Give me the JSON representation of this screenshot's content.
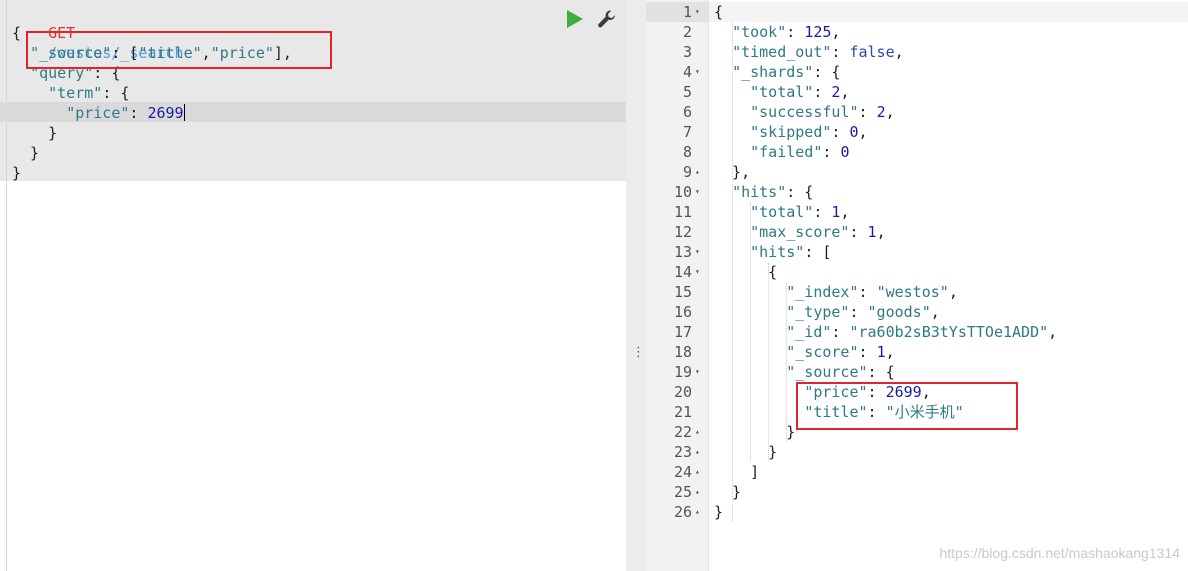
{
  "request": {
    "method": "GET",
    "path": "/westos/_search",
    "lines": [
      [
        [
          "p",
          "{"
        ]
      ],
      [
        [
          "p",
          "  "
        ],
        [
          "k",
          "\"_source\""
        ],
        [
          "p",
          ": ["
        ],
        [
          "s",
          "\"title\""
        ],
        [
          "p",
          ","
        ],
        [
          "s",
          "\"price\""
        ],
        [
          "p",
          "],"
        ]
      ],
      [
        [
          "p",
          "  "
        ],
        [
          "k",
          "\"query\""
        ],
        [
          "p",
          ": {"
        ]
      ],
      [
        [
          "p",
          "    "
        ],
        [
          "k",
          "\"term\""
        ],
        [
          "p",
          ": {"
        ]
      ],
      [
        [
          "p",
          "      "
        ],
        [
          "k",
          "\"price\""
        ],
        [
          "p",
          ": "
        ],
        [
          "n",
          "2699"
        ]
      ],
      [
        [
          "p",
          "    }"
        ]
      ],
      [
        [
          "p",
          "  }"
        ]
      ],
      [
        [
          "p",
          "}"
        ]
      ]
    ]
  },
  "toolbar": {
    "run_icon": "play-icon",
    "settings_icon": "wrench-icon",
    "run_color": "#3fae3f"
  },
  "divider": {
    "icon": "vertical-ellipsis-icon",
    "glyph": "⋮"
  },
  "response": {
    "line_numbers": [
      "1",
      "2",
      "3",
      "4",
      "5",
      "6",
      "7",
      "8",
      "9",
      "10",
      "11",
      "12",
      "13",
      "14",
      "15",
      "16",
      "17",
      "18",
      "19",
      "20",
      "21",
      "22",
      "23",
      "24",
      "25",
      "26"
    ],
    "fold_markers": {
      "0": "▾",
      "3": "▾",
      "8": "▴",
      "9": "▾",
      "12": "▾",
      "13": "▾",
      "18": "▾",
      "21": "▴",
      "22": "▴",
      "23": "▴",
      "24": "▴",
      "25": "▴"
    },
    "lines": [
      [
        [
          "p",
          "{"
        ]
      ],
      [
        [
          "p",
          "  "
        ],
        [
          "k",
          "\"took\""
        ],
        [
          "p",
          ": "
        ],
        [
          "n",
          "125"
        ],
        [
          "p",
          ","
        ]
      ],
      [
        [
          "p",
          "  "
        ],
        [
          "k",
          "\"timed_out\""
        ],
        [
          "p",
          ": "
        ],
        [
          "b",
          "false"
        ],
        [
          "p",
          ","
        ]
      ],
      [
        [
          "p",
          "  "
        ],
        [
          "k",
          "\"_shards\""
        ],
        [
          "p",
          ": {"
        ]
      ],
      [
        [
          "p",
          "    "
        ],
        [
          "k",
          "\"total\""
        ],
        [
          "p",
          ": "
        ],
        [
          "n",
          "2"
        ],
        [
          "p",
          ","
        ]
      ],
      [
        [
          "p",
          "    "
        ],
        [
          "k",
          "\"successful\""
        ],
        [
          "p",
          ": "
        ],
        [
          "n",
          "2"
        ],
        [
          "p",
          ","
        ]
      ],
      [
        [
          "p",
          "    "
        ],
        [
          "k",
          "\"skipped\""
        ],
        [
          "p",
          ": "
        ],
        [
          "n",
          "0"
        ],
        [
          "p",
          ","
        ]
      ],
      [
        [
          "p",
          "    "
        ],
        [
          "k",
          "\"failed\""
        ],
        [
          "p",
          ": "
        ],
        [
          "n",
          "0"
        ]
      ],
      [
        [
          "p",
          "  },"
        ]
      ],
      [
        [
          "p",
          "  "
        ],
        [
          "k",
          "\"hits\""
        ],
        [
          "p",
          ": {"
        ]
      ],
      [
        [
          "p",
          "    "
        ],
        [
          "k",
          "\"total\""
        ],
        [
          "p",
          ": "
        ],
        [
          "n",
          "1"
        ],
        [
          "p",
          ","
        ]
      ],
      [
        [
          "p",
          "    "
        ],
        [
          "k",
          "\"max_score\""
        ],
        [
          "p",
          ": "
        ],
        [
          "n",
          "1"
        ],
        [
          "p",
          ","
        ]
      ],
      [
        [
          "p",
          "    "
        ],
        [
          "k",
          "\"hits\""
        ],
        [
          "p",
          ": ["
        ]
      ],
      [
        [
          "p",
          "      {"
        ]
      ],
      [
        [
          "p",
          "        "
        ],
        [
          "k",
          "\"_index\""
        ],
        [
          "p",
          ": "
        ],
        [
          "s",
          "\"westos\""
        ],
        [
          "p",
          ","
        ]
      ],
      [
        [
          "p",
          "        "
        ],
        [
          "k",
          "\"_type\""
        ],
        [
          "p",
          ": "
        ],
        [
          "s",
          "\"goods\""
        ],
        [
          "p",
          ","
        ]
      ],
      [
        [
          "p",
          "        "
        ],
        [
          "k",
          "\"_id\""
        ],
        [
          "p",
          ": "
        ],
        [
          "s",
          "\"ra60b2sB3tYsTTOe1ADD\""
        ],
        [
          "p",
          ","
        ]
      ],
      [
        [
          "p",
          "        "
        ],
        [
          "k",
          "\"_score\""
        ],
        [
          "p",
          ": "
        ],
        [
          "n",
          "1"
        ],
        [
          "p",
          ","
        ]
      ],
      [
        [
          "p",
          "        "
        ],
        [
          "k",
          "\"_source\""
        ],
        [
          "p",
          ": {"
        ]
      ],
      [
        [
          "p",
          "          "
        ],
        [
          "k",
          "\"price\""
        ],
        [
          "p",
          ": "
        ],
        [
          "n",
          "2699"
        ],
        [
          "p",
          ","
        ]
      ],
      [
        [
          "p",
          "          "
        ],
        [
          "k",
          "\"title\""
        ],
        [
          "p",
          ": "
        ],
        [
          "s",
          "\"小米手机\""
        ]
      ],
      [
        [
          "p",
          "        }"
        ]
      ],
      [
        [
          "p",
          "      }"
        ]
      ],
      [
        [
          "p",
          "    ]"
        ]
      ],
      [
        [
          "p",
          "  }"
        ]
      ],
      [
        [
          "p",
          "}"
        ]
      ]
    ]
  },
  "watermark": "https://blog.csdn.net/mashaokang1314",
  "highlight_color": "#e0262a"
}
